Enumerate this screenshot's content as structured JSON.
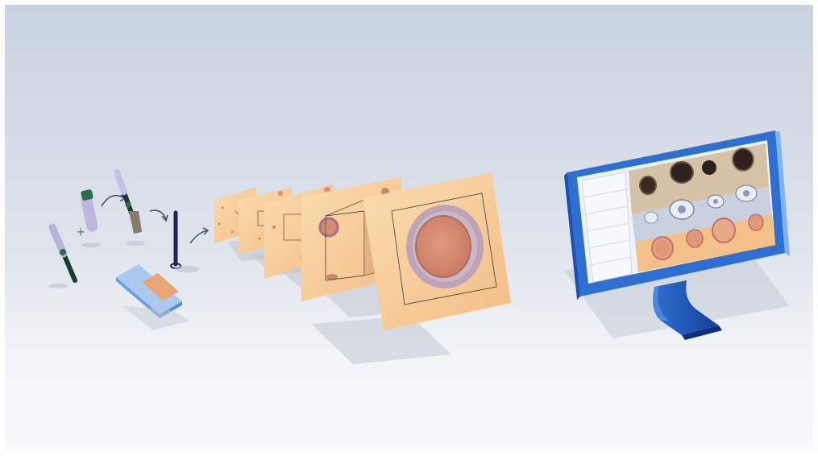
{
  "labels": {
    "plus_sign": "+"
  },
  "colors": {
    "background_top": "#c9d2e1",
    "background_bottom": "#f7f8fa",
    "paper": "#f6c98f",
    "paper_light": "#fbe3bf",
    "cell_core": "#d98c73",
    "cell_ring": "#b8a1b4",
    "monitor_frame": "#2f6fd0",
    "monitor_stand": "#1c4fb8",
    "egg_dark": "#3a2a22",
    "egg_gray": "#e9edf3"
  },
  "icons": [
    "swab-icon",
    "test-tube-icon",
    "brush-icon",
    "slide-icon",
    "stirring-rod-icon",
    "monitor-icon"
  ],
  "stack_layers": 5,
  "monitor_panels": {
    "rows": 3,
    "left_column_rows": 6
  }
}
